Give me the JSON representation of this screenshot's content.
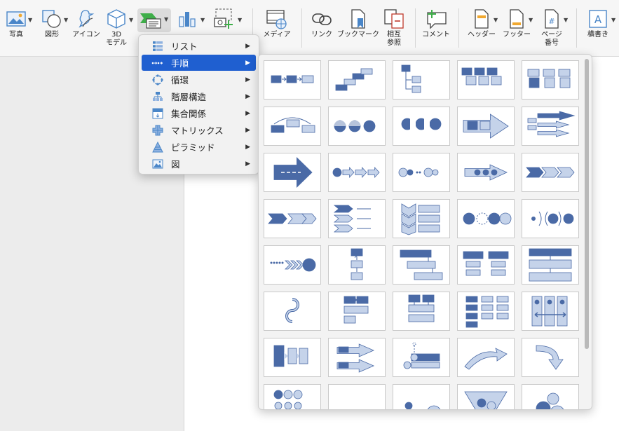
{
  "ribbon": {
    "photo_label": "写真",
    "shapes_label": "図形",
    "icons_label": "アイコン",
    "model3d_label": "3D\nモデル",
    "media_label": "メディア",
    "link_label": "リンク",
    "bookmark_label": "ブックマーク",
    "crossref_label": "相互\n参照",
    "comment_label": "コメント",
    "header_label": "ヘッダー",
    "footer_label": "フッター",
    "pagenum_label": "ページ\n番号",
    "textbox_label": "横書き"
  },
  "smartart_menu": {
    "items": [
      {
        "label": "リスト",
        "icon": "list-icon"
      },
      {
        "label": "手順",
        "icon": "process-icon",
        "selected": true
      },
      {
        "label": "循環",
        "icon": "cycle-icon"
      },
      {
        "label": "階層構造",
        "icon": "hierarchy-icon"
      },
      {
        "label": "集合関係",
        "icon": "relationship-icon"
      },
      {
        "label": "マトリックス",
        "icon": "matrix-icon"
      },
      {
        "label": "ピラミッド",
        "icon": "pyramid-icon"
      },
      {
        "label": "図",
        "icon": "picture-icon"
      }
    ]
  },
  "colors": {
    "accent": "#1f5fd0",
    "shape_dark": "#4a6aa6",
    "shape_light": "#c5d3ea"
  }
}
